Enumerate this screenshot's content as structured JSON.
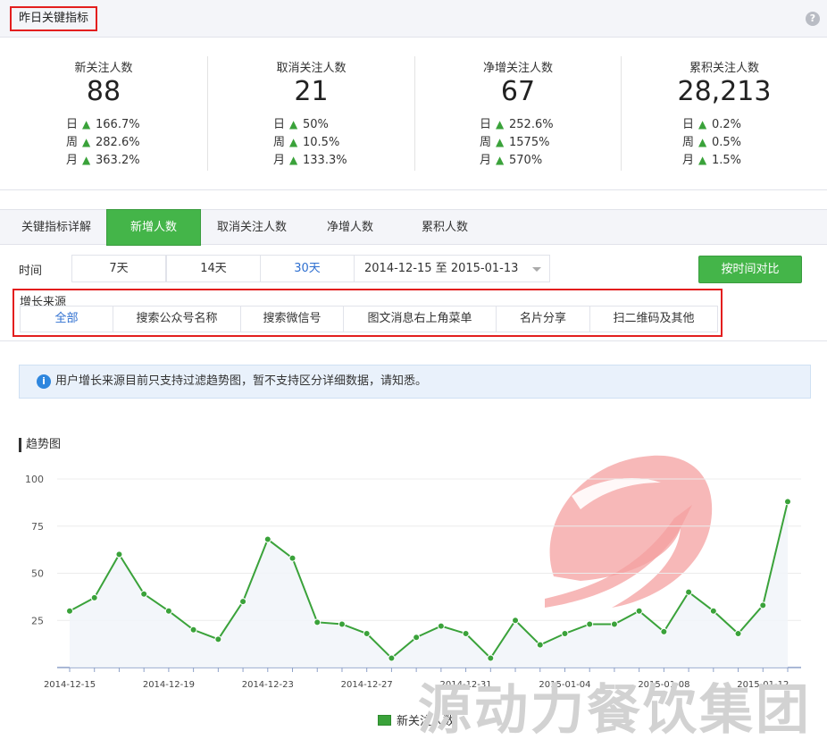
{
  "header": {
    "title": "昨日关键指标",
    "help_icon": "?"
  },
  "stats": [
    {
      "label": "新关注人数",
      "value": "88",
      "rows": [
        {
          "period": "日",
          "pct": "166.7%"
        },
        {
          "period": "周",
          "pct": "282.6%"
        },
        {
          "period": "月",
          "pct": "363.2%"
        }
      ]
    },
    {
      "label": "取消关注人数",
      "value": "21",
      "rows": [
        {
          "period": "日",
          "pct": "50%"
        },
        {
          "period": "周",
          "pct": "10.5%"
        },
        {
          "period": "月",
          "pct": "133.3%"
        }
      ]
    },
    {
      "label": "净增关注人数",
      "value": "67",
      "rows": [
        {
          "period": "日",
          "pct": "252.6%"
        },
        {
          "period": "周",
          "pct": "1575%"
        },
        {
          "period": "月",
          "pct": "570%"
        }
      ]
    },
    {
      "label": "累积关注人数",
      "value": "28,213",
      "rows": [
        {
          "period": "日",
          "pct": "0.2%"
        },
        {
          "period": "周",
          "pct": "0.5%"
        },
        {
          "period": "月",
          "pct": "1.5%"
        }
      ]
    }
  ],
  "tabs": {
    "section_label": "关键指标详解",
    "items": [
      "新增人数",
      "取消关注人数",
      "净增人数",
      "累积人数"
    ],
    "active": "新增人数"
  },
  "time": {
    "label": "时间",
    "options": [
      "7天",
      "14天",
      "30天"
    ],
    "selected": "30天",
    "date_range": "2014-12-15 至 2015-01-13",
    "compare_button": "按时间对比"
  },
  "source": {
    "label": "增长来源",
    "items": [
      "全部",
      "搜索公众号名称",
      "搜索微信号",
      "图文消息右上角菜单",
      "名片分享",
      "扫二维码及其他"
    ],
    "selected": "全部"
  },
  "info": {
    "text": "用户增长来源目前只支持过滤趋势图，暂不支持区分详细数据，请知悉。"
  },
  "trend": {
    "title": "趋势图"
  },
  "chart_data": {
    "type": "line",
    "series": [
      {
        "name": "新关注人数",
        "color": "#3aa23a",
        "values": [
          30,
          37,
          60,
          39,
          30,
          20,
          15,
          35,
          68,
          58,
          24,
          23,
          18,
          5,
          16,
          22,
          18,
          5,
          25,
          12,
          18,
          23,
          23,
          30,
          19,
          40,
          30,
          18,
          33,
          88
        ]
      }
    ],
    "x": [
      "2014-12-15",
      "2014-12-16",
      "2014-12-17",
      "2014-12-18",
      "2014-12-19",
      "2014-12-20",
      "2014-12-21",
      "2014-12-22",
      "2014-12-23",
      "2014-12-24",
      "2014-12-25",
      "2014-12-26",
      "2014-12-27",
      "2014-12-28",
      "2014-12-29",
      "2014-12-30",
      "2014-12-31",
      "2015-01-01",
      "2015-01-02",
      "2015-01-03",
      "2015-01-04",
      "2015-01-05",
      "2015-01-06",
      "2015-01-07",
      "2015-01-08",
      "2015-01-09",
      "2015-01-10",
      "2015-01-11",
      "2015-01-12",
      "2015-01-13"
    ],
    "x_tick_labels": [
      "2014-12-15",
      "2014-12-19",
      "2014-12-23",
      "2014-12-27",
      "2014-12-31",
      "2015-01-04",
      "2015-01-08",
      "2015-01-12"
    ],
    "y_ticks": [
      25,
      50,
      75,
      100
    ],
    "ylim": [
      0,
      100
    ],
    "grid": true,
    "legend": "bottom-center"
  },
  "watermark": {
    "text": "源动力餐饮集团"
  }
}
